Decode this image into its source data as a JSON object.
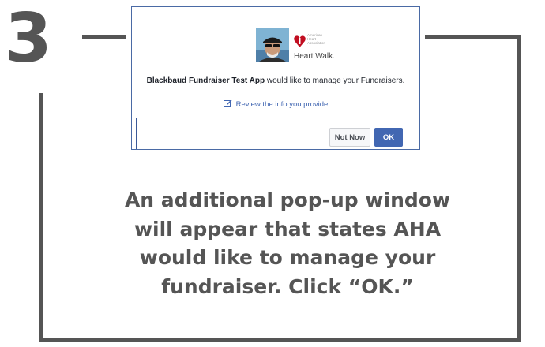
{
  "step": {
    "number": "3"
  },
  "dialog": {
    "app_name": "Blackbaud Fundraiser Test App",
    "message_suffix": " would like to manage your Fundraisers.",
    "review_link": "Review the info you provide",
    "not_now_label": "Not Now",
    "ok_label": "OK",
    "logo_small_text": "American Heart Association",
    "logo_text": "Heart Walk."
  },
  "instruction": {
    "lines": [
      "An additional pop-up window",
      "will appear that states AHA",
      "would like to manage your",
      "fundraiser. Click “OK.”"
    ]
  },
  "colors": {
    "frame": "#555555",
    "accent_blue": "#4267b2",
    "aha_red": "#c10e21"
  },
  "icons": [
    "edit-icon",
    "heart-torch-icon"
  ]
}
